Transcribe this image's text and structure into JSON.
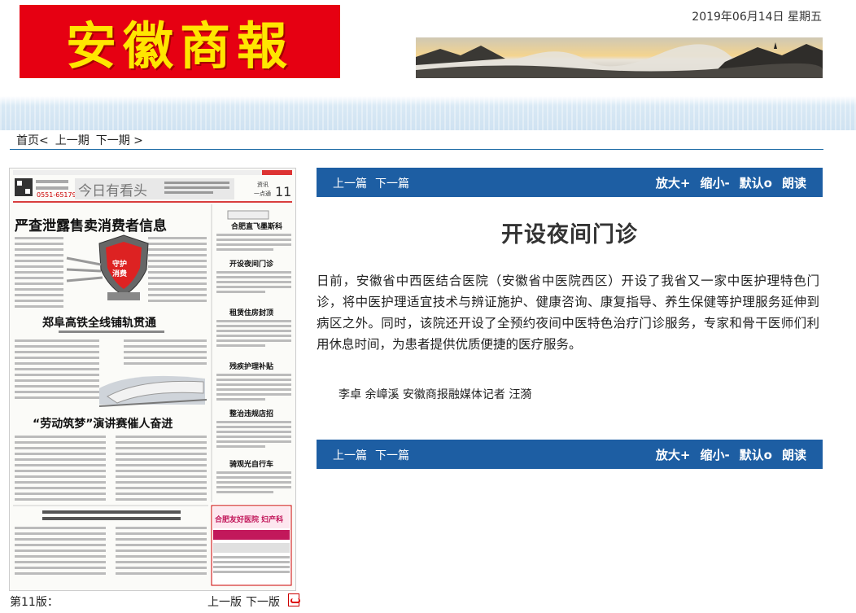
{
  "header": {
    "logo_text": "安徽商報",
    "date": "2019年06月14日 星期五"
  },
  "nav": {
    "home": "首页<",
    "prev": "上一期",
    "next": "下一期 >"
  },
  "page_preview": {
    "headlines": [
      "今日有看头",
      "严查泄露售卖消费者信息",
      "郑阜高铁全线铺轨贯通",
      "“劳动筑梦”演讲赛催人奋进",
      "合肥直飞墨斯科",
      "开设夜间门诊",
      "租赁住房封顶",
      "残疾护理补贴",
      "整治违规店招",
      "骑观光自行车"
    ],
    "ad_text": "合肥友好医院 妇产科"
  },
  "pagebar": {
    "page_label": "第11版：",
    "prev": "上一版",
    "next": "下一版"
  },
  "toolbar": {
    "prev_article": "上一篇",
    "next_article": "下一篇",
    "zoom_in": "放大+",
    "zoom_out": "缩小-",
    "default": "默认o",
    "read": "朗读"
  },
  "article": {
    "title": "开设夜间门诊",
    "body": "日前，安徽省中西医结合医院（安徽省中医院西区）开设了我省又一家中医护理特色门诊，将中医护理适宜技术与辨证施护、健康咨询、康复指导、养生保健等护理服务延伸到病区之外。同时，该院还开设了全预约夜间中医特色治疗门诊服务，专家和骨干医师们利用休息时间，为患者提供优质便捷的医疗服务。",
    "byline": "李卓 余嶂溪 安徽商报融媒体记者 汪漪"
  }
}
